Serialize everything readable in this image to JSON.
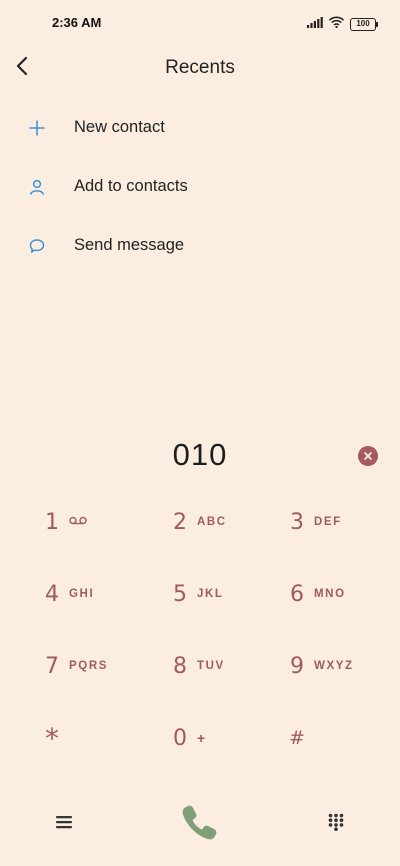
{
  "status_bar": {
    "time": "2:36 AM",
    "battery": "100",
    "icons": [
      "signal-icon",
      "wifi-icon",
      "battery-icon"
    ]
  },
  "header": {
    "title": "Recents",
    "back_icon": "chevron-left-icon"
  },
  "menu": {
    "items": [
      {
        "label": "New contact",
        "icon": "plus-icon"
      },
      {
        "label": "Add to contacts",
        "icon": "person-icon"
      },
      {
        "label": "Send message",
        "icon": "chat-bubble-icon"
      }
    ]
  },
  "dialer": {
    "number": "010",
    "delete_icon": "backspace-circle-icon"
  },
  "keypad": {
    "rows": [
      [
        {
          "digit": "1",
          "letters": ""
        },
        {
          "digit": "2",
          "letters": "ABC"
        },
        {
          "digit": "3",
          "letters": "DEF"
        }
      ],
      [
        {
          "digit": "4",
          "letters": "GHI"
        },
        {
          "digit": "5",
          "letters": "JKL"
        },
        {
          "digit": "6",
          "letters": "MNO"
        }
      ],
      [
        {
          "digit": "7",
          "letters": "PQRS"
        },
        {
          "digit": "8",
          "letters": "TUV"
        },
        {
          "digit": "9",
          "letters": "WXYZ"
        }
      ],
      [
        {
          "digit": "*",
          "letters": ""
        },
        {
          "digit": "0",
          "letters": "+"
        },
        {
          "digit": "#",
          "letters": ""
        }
      ]
    ]
  },
  "bottom_bar": {
    "menu_icon": "hamburger-icon",
    "call_icon": "phone-icon",
    "dialpad_icon": "dialpad-icon"
  },
  "colors": {
    "background": "#fbeee0",
    "accent_blue": "#3a8fd6",
    "keypad_rose": "#a05a5e",
    "call_green": "#7f9f7a"
  }
}
